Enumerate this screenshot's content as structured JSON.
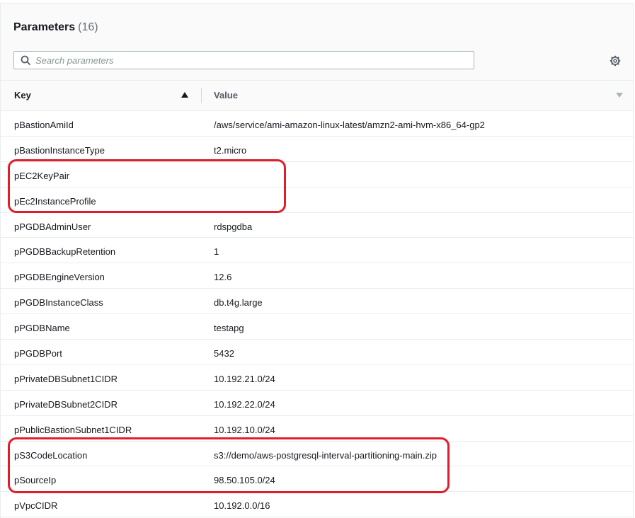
{
  "header": {
    "title": "Parameters",
    "count": "(16)"
  },
  "search": {
    "placeholder": "Search parameters",
    "icon": "search-icon"
  },
  "settings": {
    "icon": "gear-icon"
  },
  "table": {
    "columns": {
      "key": "Key",
      "value": "Value"
    },
    "sort": {
      "column": "Key",
      "direction": "ascending"
    },
    "rows": [
      {
        "key": "pBastionAmiId",
        "value": "/aws/service/ami-amazon-linux-latest/amzn2-ami-hvm-x86_64-gp2"
      },
      {
        "key": "pBastionInstanceType",
        "value": "t2.micro"
      },
      {
        "key": "pEC2KeyPair",
        "value": ""
      },
      {
        "key": "pEc2InstanceProfile",
        "value": ""
      },
      {
        "key": "pPGDBAdminUser",
        "value": "rdspgdba"
      },
      {
        "key": "pPGDBBackupRetention",
        "value": "1"
      },
      {
        "key": "pPGDBEngineVersion",
        "value": "12.6"
      },
      {
        "key": "pPGDBInstanceClass",
        "value": "db.t4g.large"
      },
      {
        "key": "pPGDBName",
        "value": "testapg"
      },
      {
        "key": "pPGDBPort",
        "value": "5432"
      },
      {
        "key": "pPrivateDBSubnet1CIDR",
        "value": "10.192.21.0/24"
      },
      {
        "key": "pPrivateDBSubnet2CIDR",
        "value": "10.192.22.0/24"
      },
      {
        "key": "pPublicBastionSubnet1CIDR",
        "value": "10.192.10.0/24"
      },
      {
        "key": "pS3CodeLocation",
        "value": "s3://demo/aws-postgresql-interval-partitioning-main.zip"
      },
      {
        "key": "pSourceIp",
        "value": "98.50.105.0/24"
      },
      {
        "key": "pVpcCIDR",
        "value": "10.192.0.0/16"
      }
    ]
  },
  "annotations": {
    "highlight_color": "#e01e2b"
  }
}
